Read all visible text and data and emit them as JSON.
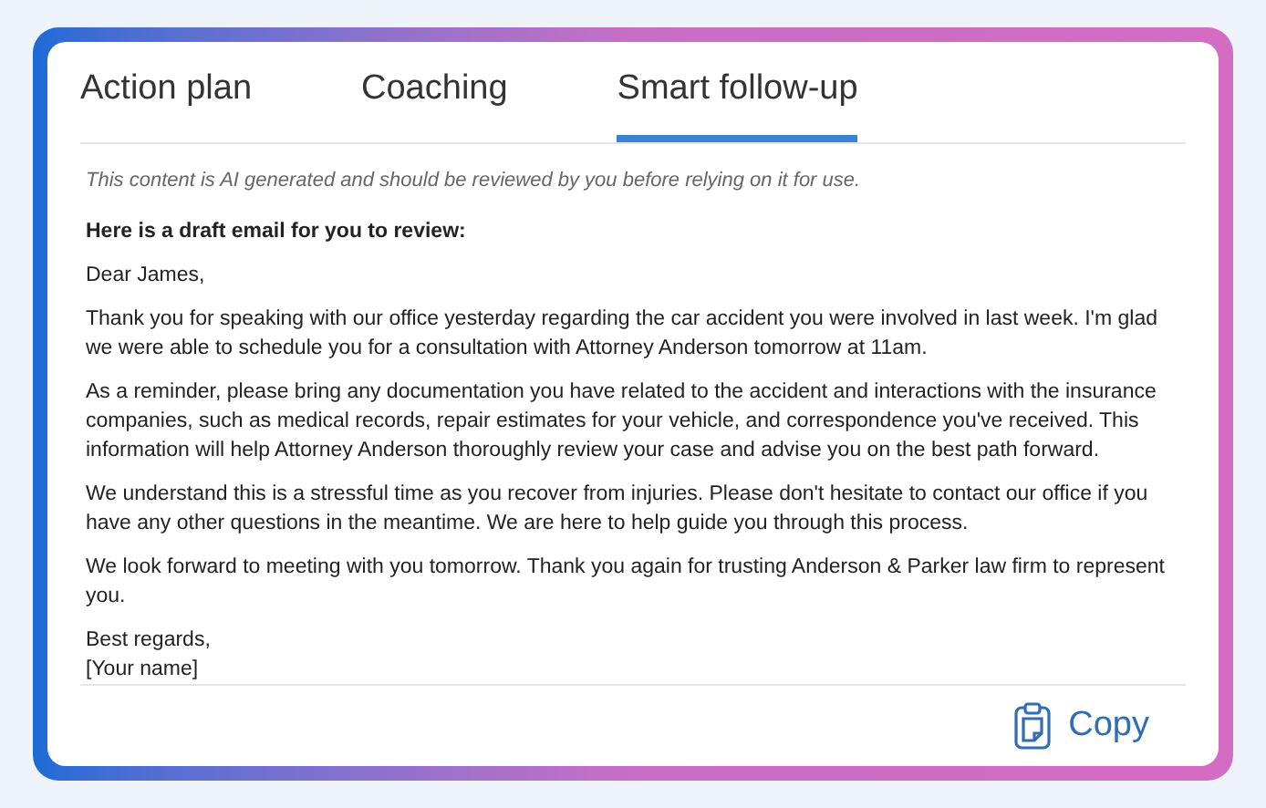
{
  "tabs": [
    {
      "label": "Action plan",
      "selected": false
    },
    {
      "label": "Coaching",
      "selected": false
    },
    {
      "label": "Smart follow-up",
      "selected": true
    }
  ],
  "disclaimer": "This content is AI generated and should be reviewed by you before relying on it for use.",
  "heading": "Here is a draft email for you to review:",
  "greeting": "Dear James,",
  "paragraphs": [
    "Thank you for speaking with our office yesterday regarding the car accident you were involved in last week. I'm glad we were able to schedule you for a consultation with Attorney Anderson tomorrow at 11am.",
    "As a reminder, please bring any documentation you have related to the accident and interactions with the insurance companies, such as medical records, repair estimates for your vehicle, and correspondence you've received. This information will help Attorney Anderson thoroughly review your case and advise you on the best path forward.",
    "We understand this is a stressful time as you recover from injuries. Please don't hesitate to contact our office if you have any other questions in the meantime. We are here to help guide you through this process.",
    "We look forward to meeting with you tomorrow. Thank you again for trusting Anderson & Parker law firm to represent you."
  ],
  "signature": [
    "Best regards,",
    "[Your name]"
  ],
  "copy_button": "Copy"
}
